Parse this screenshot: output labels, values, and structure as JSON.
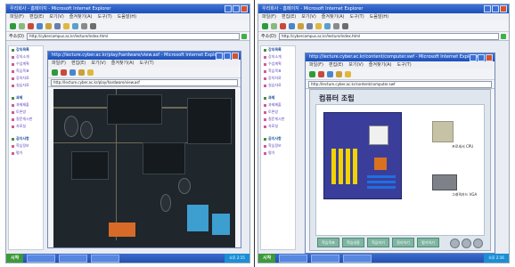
{
  "left_screen": {
    "browser_title": "우리회사 - 홈페이지 - Microsoft Internet Explorer",
    "menu": [
      "파일(F)",
      "편집(E)",
      "보기(V)",
      "즐겨찾기(A)",
      "도구(T)",
      "도움말(H)"
    ],
    "address_label": "주소(D)",
    "address_value": "http://cybercampus.ac.kr/lecture/index.html",
    "sidebar_items": [
      {
        "label": "강의목록",
        "head": true
      },
      {
        "label": "강의소개",
        "head": false
      },
      {
        "label": "수업계획",
        "head": false
      },
      {
        "label": "학습목표",
        "head": false
      },
      {
        "label": "강의자료",
        "head": false
      },
      {
        "label": "실습자료",
        "head": false
      },
      {
        "label": "과제",
        "head": true
      },
      {
        "label": "과제제출",
        "head": false
      },
      {
        "label": "토론방",
        "head": false
      },
      {
        "label": "질문게시판",
        "head": false
      },
      {
        "label": "자료실",
        "head": false
      },
      {
        "label": "공지사항",
        "head": true
      },
      {
        "label": "학습정보",
        "head": false
      },
      {
        "label": "평가",
        "head": false
      }
    ],
    "inner_window": {
      "title": "http://lecture.cyber.ac.kr/play/hardware/view.asf - Microsoft Internet Explorer",
      "address_value": "http://lecture.cyber.ac.kr/play/hardware/view.asf"
    },
    "taskbar": {
      "start": "시작",
      "tray": "오후 2:15"
    }
  },
  "right_screen": {
    "browser_title": "우리회사 - 홈페이지 - Microsoft Internet Explorer",
    "menu": [
      "파일(F)",
      "편집(E)",
      "보기(V)",
      "즐겨찾기(A)",
      "도구(T)",
      "도움말(H)"
    ],
    "address_label": "주소(D)",
    "address_value": "http://cybercampus.ac.kr/lecture/index.html",
    "sidebar_items": [
      {
        "label": "강의목록",
        "head": true
      },
      {
        "label": "강의소개",
        "head": false
      },
      {
        "label": "수업계획",
        "head": false
      },
      {
        "label": "학습목표",
        "head": false
      },
      {
        "label": "강의자료",
        "head": false
      },
      {
        "label": "실습자료",
        "head": false
      },
      {
        "label": "과제",
        "head": true
      },
      {
        "label": "과제제출",
        "head": false
      },
      {
        "label": "토론방",
        "head": false
      },
      {
        "label": "질문게시판",
        "head": false
      },
      {
        "label": "자료실",
        "head": false
      },
      {
        "label": "공지사항",
        "head": true
      },
      {
        "label": "학습정보",
        "head": false
      },
      {
        "label": "평가",
        "head": false
      }
    ],
    "inner_window": {
      "title": "http://lecture.cyber.ac.kr/content/computer.swf - Microsoft Internet Explorer",
      "address_value": "http://lecture.cyber.ac.kr/content/computer.swf"
    },
    "content": {
      "heading": "컴퓨터 조립",
      "cpu_label": "프로세서 CPU",
      "gpu_label": "그래픽카드 VGA",
      "nav_buttons": [
        "학습목표",
        "학습내용",
        "학습하기",
        "정리하기",
        "평가하기"
      ]
    },
    "taskbar": {
      "start": "시작",
      "tray": "오후 2:16"
    }
  },
  "colors": {
    "titlebar": "#1d4fb6",
    "accent_green": "#3c9a3a",
    "sidebar_link": "#5a3db8"
  }
}
